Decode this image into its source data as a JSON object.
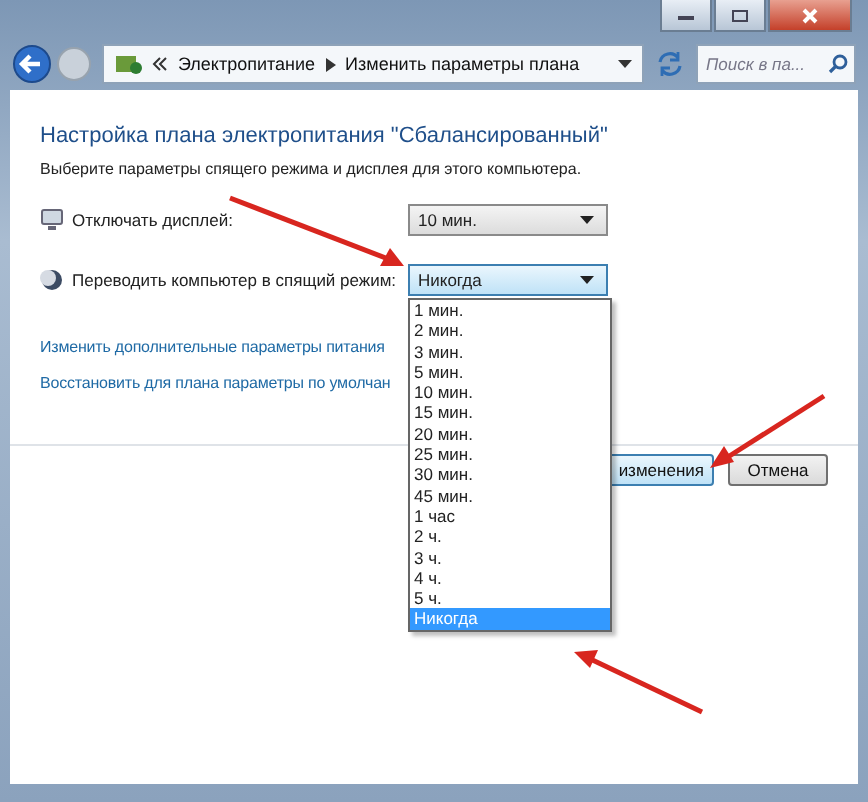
{
  "address_bar": {
    "breadcrumbs": [
      "Электропитание",
      "Изменить параметры плана"
    ],
    "search": {
      "placeholder": "Поиск в па..."
    }
  },
  "heading": "Настройка плана электропитания \"Сбалансированный\"",
  "subheading": "Выберите параметры спящего режима и дисплея для этого компьютера.",
  "settings": [
    {
      "kind": "display",
      "label": "Отключать дисплей:",
      "value": "10 мин.",
      "expanded": false
    },
    {
      "kind": "sleep",
      "label": "Переводить компьютер в спящий режим:",
      "value": "Никогда",
      "expanded": true
    }
  ],
  "dropdown_options": [
    {
      "label": "1 мин.",
      "selected": false
    },
    {
      "label": "2 мин.",
      "selected": false
    },
    {
      "label": "3 мин.",
      "selected": false
    },
    {
      "label": "5 мин.",
      "selected": false
    },
    {
      "label": "10 мин.",
      "selected": false
    },
    {
      "label": "15 мин.",
      "selected": false
    },
    {
      "label": "20 мин.",
      "selected": false
    },
    {
      "label": "25 мин.",
      "selected": false
    },
    {
      "label": "30 мин.",
      "selected": false
    },
    {
      "label": "45 мин.",
      "selected": false
    },
    {
      "label": "1 час",
      "selected": false
    },
    {
      "label": "2 ч.",
      "selected": false
    },
    {
      "label": "3 ч.",
      "selected": false
    },
    {
      "label": "4 ч.",
      "selected": false
    },
    {
      "label": "5 ч.",
      "selected": false
    },
    {
      "label": "Никогда",
      "selected": true
    }
  ],
  "links": [
    "Изменить дополнительные параметры питания",
    "Восстановить для плана параметры по умолчан"
  ],
  "buttons": [
    "изменения",
    "Отмена"
  ]
}
